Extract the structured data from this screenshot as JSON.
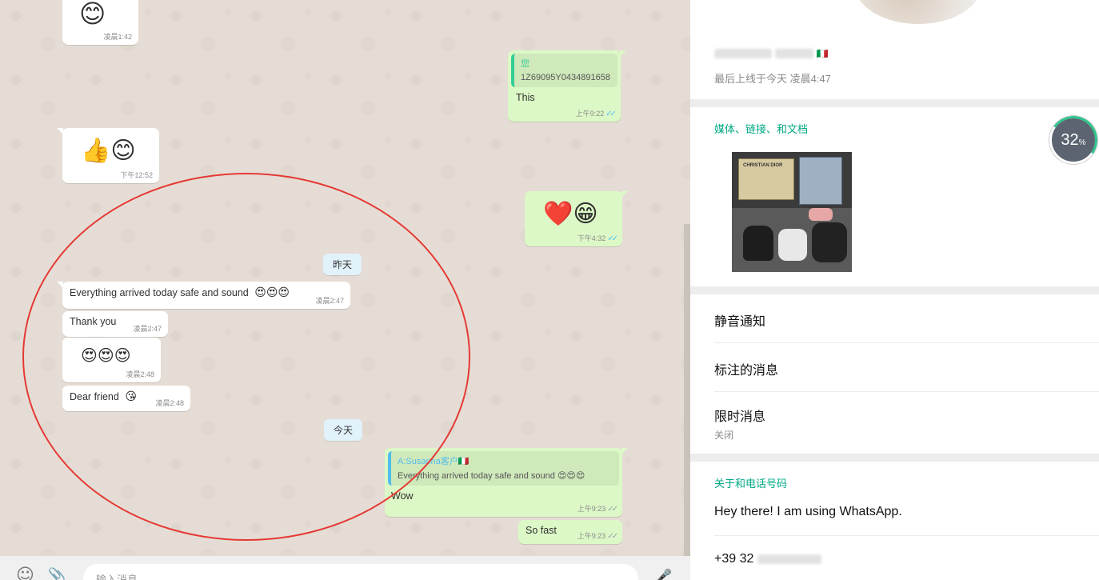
{
  "chat": {
    "messages": [
      {
        "id": "m1",
        "direction": "in",
        "emoji": "😊",
        "time": "凌晨1:42"
      },
      {
        "id": "m2",
        "direction": "out",
        "quote_author": "您",
        "quote_text": "1Z69095Y0434891658",
        "text": "This",
        "time": "上午9:22",
        "ticks": "✓✓"
      },
      {
        "id": "m3",
        "direction": "in",
        "emoji": "👍😊",
        "time": "下午12:52"
      },
      {
        "id": "m4",
        "direction": "out",
        "emoji": "❤️😁",
        "time": "下午4:32",
        "ticks": "✓✓"
      },
      {
        "id": "m5",
        "direction": "in",
        "text": "Everything arrived today safe and sound",
        "emoji": "😍😍😍",
        "time": "凌晨2:47"
      },
      {
        "id": "m6",
        "direction": "in",
        "text": "Thank you",
        "time": "凌晨2:47"
      },
      {
        "id": "m7",
        "direction": "in",
        "emoji": "😍😍😍",
        "time": "凌晨2:48"
      },
      {
        "id": "m8",
        "direction": "in",
        "text": "Dear friend",
        "emoji": "😘",
        "time": "凌晨2:48"
      },
      {
        "id": "m9",
        "direction": "out",
        "quote_author": "A:Susanna客户🇮🇹",
        "quote_text": "Everything arrived today safe and sound 😍😍😍",
        "text": "Wow",
        "time": "上午9:23",
        "ticks": "✓✓"
      },
      {
        "id": "m10",
        "direction": "out",
        "text": "So fast",
        "time": "上午9:23",
        "ticks": "✓✓"
      }
    ],
    "date_dividers": {
      "yesterday": "昨天",
      "today": "今天"
    },
    "composer": {
      "placeholder": "输入消息",
      "emoji_icon": "☺",
      "attach_icon": "📎",
      "mic_icon": "🎤"
    }
  },
  "panel": {
    "contact_name_suffix": "🇮🇹",
    "last_seen": "最后上线于今天 凌晨4:47",
    "media_section_title": "媒体、链接、和文档",
    "media_thumb_label": "CHRISTIAN DIOR",
    "progress_value": "32",
    "progress_unit": "%",
    "mute_label": "静音通知",
    "starred_label": "标注的消息",
    "disappearing_label": "限时消息",
    "disappearing_value": "关闭",
    "about_section_title": "关于和电话号码",
    "about_text": "Hey there! I am using WhatsApp.",
    "phone_prefix": "+39 32"
  },
  "colors": {
    "chat_bg": "#e5ddd5",
    "outgoing_bubble": "#dcf8c6",
    "incoming_bubble": "#ffffff",
    "accent_green": "#00a884",
    "read_ticks": "#4fc3f7",
    "annotation_circle": "#e53935"
  }
}
